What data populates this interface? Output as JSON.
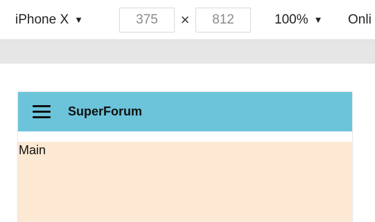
{
  "devtools_toolbar": {
    "device_name": "iPhone X",
    "device_caret": "▼",
    "width_value": "375",
    "times_symbol": "×",
    "height_value": "812",
    "zoom_value": "100%",
    "zoom_caret": "▼",
    "throttle_text": "Onli"
  },
  "app": {
    "header": {
      "menu_icon": "hamburger-menu-icon",
      "title": "SuperForum",
      "background_color": "#6cc4da"
    },
    "main": {
      "label": "Main",
      "background_color": "#fde9d3"
    }
  }
}
